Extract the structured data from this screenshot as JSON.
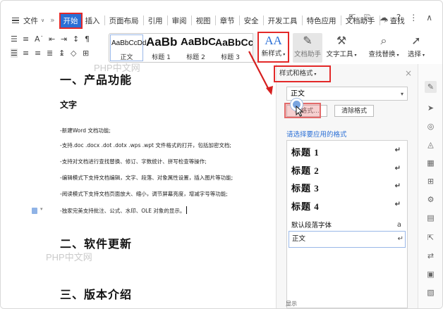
{
  "menu": {
    "file_label": "文件",
    "items": [
      "开始",
      "插入",
      "页面布局",
      "引用",
      "审阅",
      "视图",
      "章节",
      "安全",
      "开发工具",
      "特色应用",
      "文档助手"
    ],
    "search_label": "查找",
    "help_label": "?"
  },
  "ribbon": {
    "style_gallery": [
      {
        "sample": "AaBbCcDd",
        "name": "正文"
      },
      {
        "sample": "AaBb",
        "name": "标题 1"
      },
      {
        "sample": "AaBbC",
        "name": "标题 2"
      },
      {
        "sample": "AaBbCc",
        "name": "标题 3"
      }
    ],
    "new_style_label": "新样式",
    "new_style_glyph": "AA",
    "doc_helper_label": "文档助手",
    "text_tools_label": "文字工具",
    "find_replace_label": "查找替换",
    "select_label": "选择"
  },
  "document": {
    "heading1": "一、产品功能",
    "heading_text": "文字",
    "bullets": [
      "-新建Word 文档功能;",
      "-支持.doc .docx .dot .dotx .wps .wpt 文件格式的打开，包括加密文档;",
      "-支持对文档进行查找替换、修订、字数统计、拼写检查等操作;",
      "-编辑模式下支持文档编辑，文字、段落、对象属性设置，插入图片等功能;",
      "-阅读模式下支持文档页面放大、缩小，调节屏幕亮度，增减字号等功能;",
      "-独家完美支持批注、公式、水印、OLE 对象的显示。"
    ],
    "heading2": "二、软件更新",
    "heading3": "三、版本介绍",
    "watermark": "PHP中文网"
  },
  "panel": {
    "title": "样式和格式",
    "current_style": "正文",
    "new_format_button": "新格式...",
    "clear_format_button": "清除格式",
    "choose_label": "请选择要应用的格式",
    "styles": [
      {
        "name": "标题  1",
        "kind": "heading"
      },
      {
        "name": "标题  2",
        "kind": "heading"
      },
      {
        "name": "标题  3",
        "kind": "heading"
      },
      {
        "name": "标题  4",
        "kind": "heading"
      },
      {
        "name": "默认段落字体",
        "kind": "font"
      },
      {
        "name": "正文",
        "kind": "paragraph"
      }
    ],
    "bottom_label": "显示"
  },
  "colors": {
    "accent": "#2a6fd6",
    "highlight_red": "#e32929"
  }
}
